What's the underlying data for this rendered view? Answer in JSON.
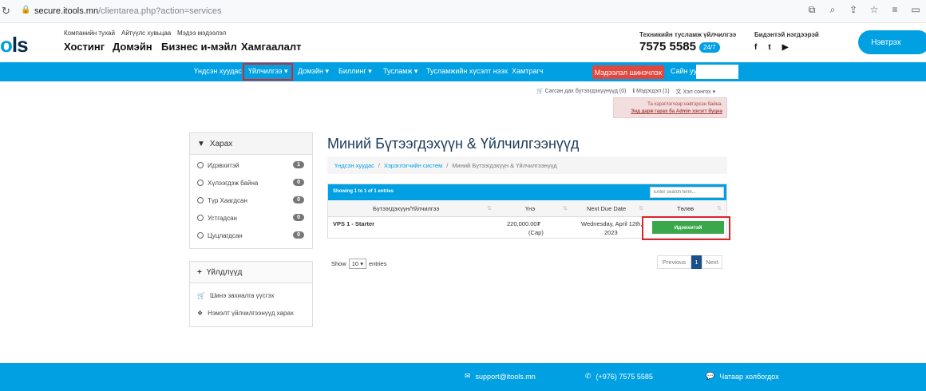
{
  "browser": {
    "url_host": "secure.itools.mn",
    "url_path": "/clientarea.php?action=services"
  },
  "header": {
    "logo_prefix": "o",
    "logo_suffix": "ls",
    "top_links": [
      "Компанийн тухай",
      "Айтүүлс хувьцаа",
      "Мэдээ мэдээлэл"
    ],
    "main_links": [
      "Хостинг",
      "Домэйн",
      "Бизнес и-мэйл",
      "Хамгаалалт"
    ],
    "support_label": "Техникийн тусламж үйлчилгээ",
    "support_phone": "7575 5585",
    "support_badge": "24/7",
    "social_label": "Бидэнтэй нэгдээрэй",
    "social_icons": [
      "f",
      "t",
      "▶"
    ],
    "login_label": "Нэвтрэх"
  },
  "nav": {
    "items": [
      "Үндсэн хуудас",
      "Үйлчилгээ",
      "Домэйн",
      "Биллинг",
      "Тусламж",
      "Тусламжийн хүсэлт нээх",
      "Хамтрагч"
    ],
    "red_button": "Мэдээлэл шинэчлэх",
    "greeting": "Сайн уу,"
  },
  "topbar": {
    "cart": "Сагсан дах бүтээгдэхүүнүүд (0)",
    "notices": "Мэдэгдэл (1)",
    "language": "Хэл сонгох"
  },
  "alert": {
    "line1": "Та хэрэглэгчээр нэвтэрсэн байна.",
    "line2": "Энд дарж гарах ба Admin хэсэгт буцна"
  },
  "sidebar": {
    "filter_title": "Харах",
    "filters": [
      {
        "label": "Идэвхитэй",
        "count": "1"
      },
      {
        "label": "Хүлээгдэж байна",
        "count": "0"
      },
      {
        "label": "Түр Хаагдсан",
        "count": "0"
      },
      {
        "label": "Устгадсан",
        "count": "0"
      },
      {
        "label": "Цуцлагдсан",
        "count": "0"
      }
    ],
    "actions_title": "Үйлдлүүд",
    "actions": [
      "Шинэ захиалга үүсгэх",
      "Нэмэлт үйлчилгээнүүд харах"
    ]
  },
  "main": {
    "title": "Миний Бүтээгдэхүүн & Үйлчилгээнүүд",
    "breadcrumb": [
      "Үндсэн хуудас",
      "Хэрэглэгчийн систем",
      "Миний Бүтээгдэхүүн & Үйлчилгээнүүд"
    ],
    "table_info": "Showing 1 to 1 of 1 entries",
    "search_placeholder": "Enter search term...",
    "columns": [
      "Бүтээгдэхүүн/Үйлчилгээ",
      "Үнэ",
      "Next Due Date",
      "Төлөв"
    ],
    "row": {
      "product": "VPS 1 - Starter",
      "price": "220,000.00₮",
      "cycle": "(Сар)",
      "due_line1": "Wednesday, April 12th,",
      "due_line2": "2023",
      "status": "Идэвхитэй"
    },
    "show_label": "Show",
    "show_value": "10",
    "entries_label": "entries",
    "pager": {
      "prev": "Previous",
      "page": "1",
      "next": "Next"
    }
  },
  "footer": {
    "email": "support@itools.mn",
    "phone": "(+976) 7575 5585",
    "chat": "Чатаар холбогдох"
  },
  "colors": {
    "brand_blue": "#00a0e3",
    "highlight_red": "#d9252a",
    "status_green": "#3aa84a"
  }
}
